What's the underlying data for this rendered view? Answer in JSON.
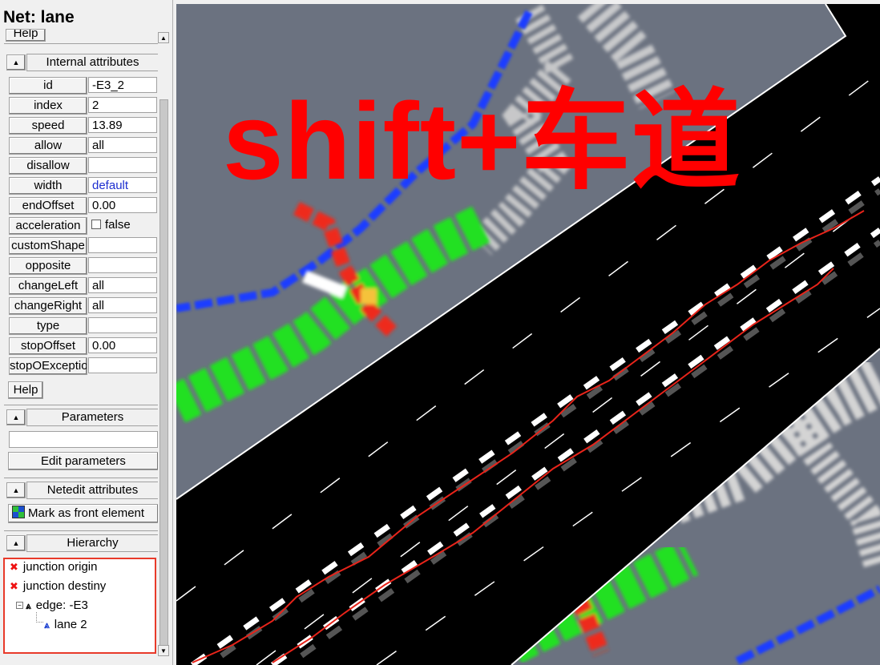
{
  "panel": {
    "title": "Net: lane",
    "help_top": "Help",
    "internal_group": "Internal attributes",
    "attributes": [
      {
        "name": "id",
        "value": "-E3_2"
      },
      {
        "name": "index",
        "value": "2"
      },
      {
        "name": "speed",
        "value": "13.89"
      },
      {
        "name": "allow",
        "value": "all"
      },
      {
        "name": "disallow",
        "value": ""
      },
      {
        "name": "width",
        "value": "default"
      },
      {
        "name": "endOffset",
        "value": "0.00"
      },
      {
        "name": "acceleration",
        "value": "false"
      },
      {
        "name": "customShape",
        "value": ""
      },
      {
        "name": "opposite",
        "value": ""
      },
      {
        "name": "changeLeft",
        "value": "all"
      },
      {
        "name": "changeRight",
        "value": "all"
      },
      {
        "name": "type",
        "value": ""
      },
      {
        "name": "stopOffset",
        "value": "0.00"
      },
      {
        "name": "stopOException",
        "value": ""
      }
    ],
    "help_label": "Help",
    "parameters_group": "Parameters",
    "parameters_value": "",
    "edit_parameters_label": "Edit parameters",
    "netedit_group": "Netedit attributes",
    "front_element_label": "Mark as front element",
    "hierarchy_group": "Hierarchy",
    "hierarchy": [
      {
        "label": "junction origin",
        "icon": "junction-icon"
      },
      {
        "label": "junction destiny",
        "icon": "junction-icon"
      },
      {
        "label": "edge: -E3",
        "icon": "edge-icon"
      },
      {
        "label": "lane 2",
        "icon": "lane-icon"
      }
    ]
  },
  "view": {
    "overlay_text": "shift+车道",
    "colors": {
      "road": "#000000",
      "background": "#6b7280",
      "highlight": "#e8241a",
      "bike_lane": "#1f3cff",
      "green_area": "#22e022"
    }
  }
}
